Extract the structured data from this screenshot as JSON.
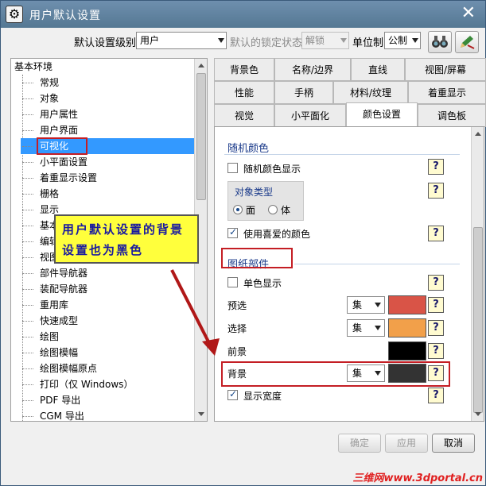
{
  "window": {
    "title": "用户默认设置",
    "close_icon": "close-icon"
  },
  "toolbar": {
    "level_label": "默认设置级别",
    "level_value": "用户",
    "lock_label": "默认的锁定状态",
    "lock_value": "解锁",
    "unit_label": "单位制",
    "unit_value": "公制",
    "button1_icon": "binoculars-icon",
    "button2_icon": "pen-arrow-icon"
  },
  "tree": {
    "root": "基本环境",
    "items": [
      "常规",
      "对象",
      "用户属性",
      "用户界面",
      "可视化",
      "小平面设置",
      "着重显示设置",
      "栅格",
      "显示",
      "基本光",
      "编辑对",
      "视图操",
      "部件导航器",
      "装配导航器",
      "重用库",
      "快速成型",
      "绘图",
      "绘图模幅",
      "绘图模幅原点",
      "打印（仅 Windows）",
      "PDF 导出",
      "CGM 导出"
    ],
    "selected_index": 4
  },
  "tabs": {
    "row1": [
      "背景色",
      "名称/边界",
      "直线",
      "视图/屏幕"
    ],
    "row2": [
      "性能",
      "手柄",
      "材料/纹理",
      "着重显示"
    ],
    "row3": [
      "视觉",
      "小平面化",
      "颜色设置",
      "调色板"
    ],
    "active": "颜色设置"
  },
  "panel": {
    "random_section": "随机颜色",
    "random_display": "随机颜色显示",
    "object_type_title": "对象类型",
    "radio_face": "面",
    "radio_body": "体",
    "use_favorite": "使用喜爱的颜色",
    "drawing_section": "图纸部件",
    "monochrome": "单色显示",
    "preselect_label": "预选",
    "select_label": "选择",
    "foreground_label": "前景",
    "background_label": "背景",
    "show_width": "显示宽度",
    "combo_value": "集",
    "help_text": "?",
    "colors": {
      "preselect": "#d95447",
      "select": "#f2a04a",
      "foreground": "#000000",
      "background": "#333333"
    }
  },
  "buttons": {
    "ok": "确定",
    "apply": "应用",
    "cancel": "取消"
  },
  "annotation": {
    "text": "用户默认设置的背景设置也为黑色"
  },
  "watermark": "三维网www.3dportal.cn"
}
